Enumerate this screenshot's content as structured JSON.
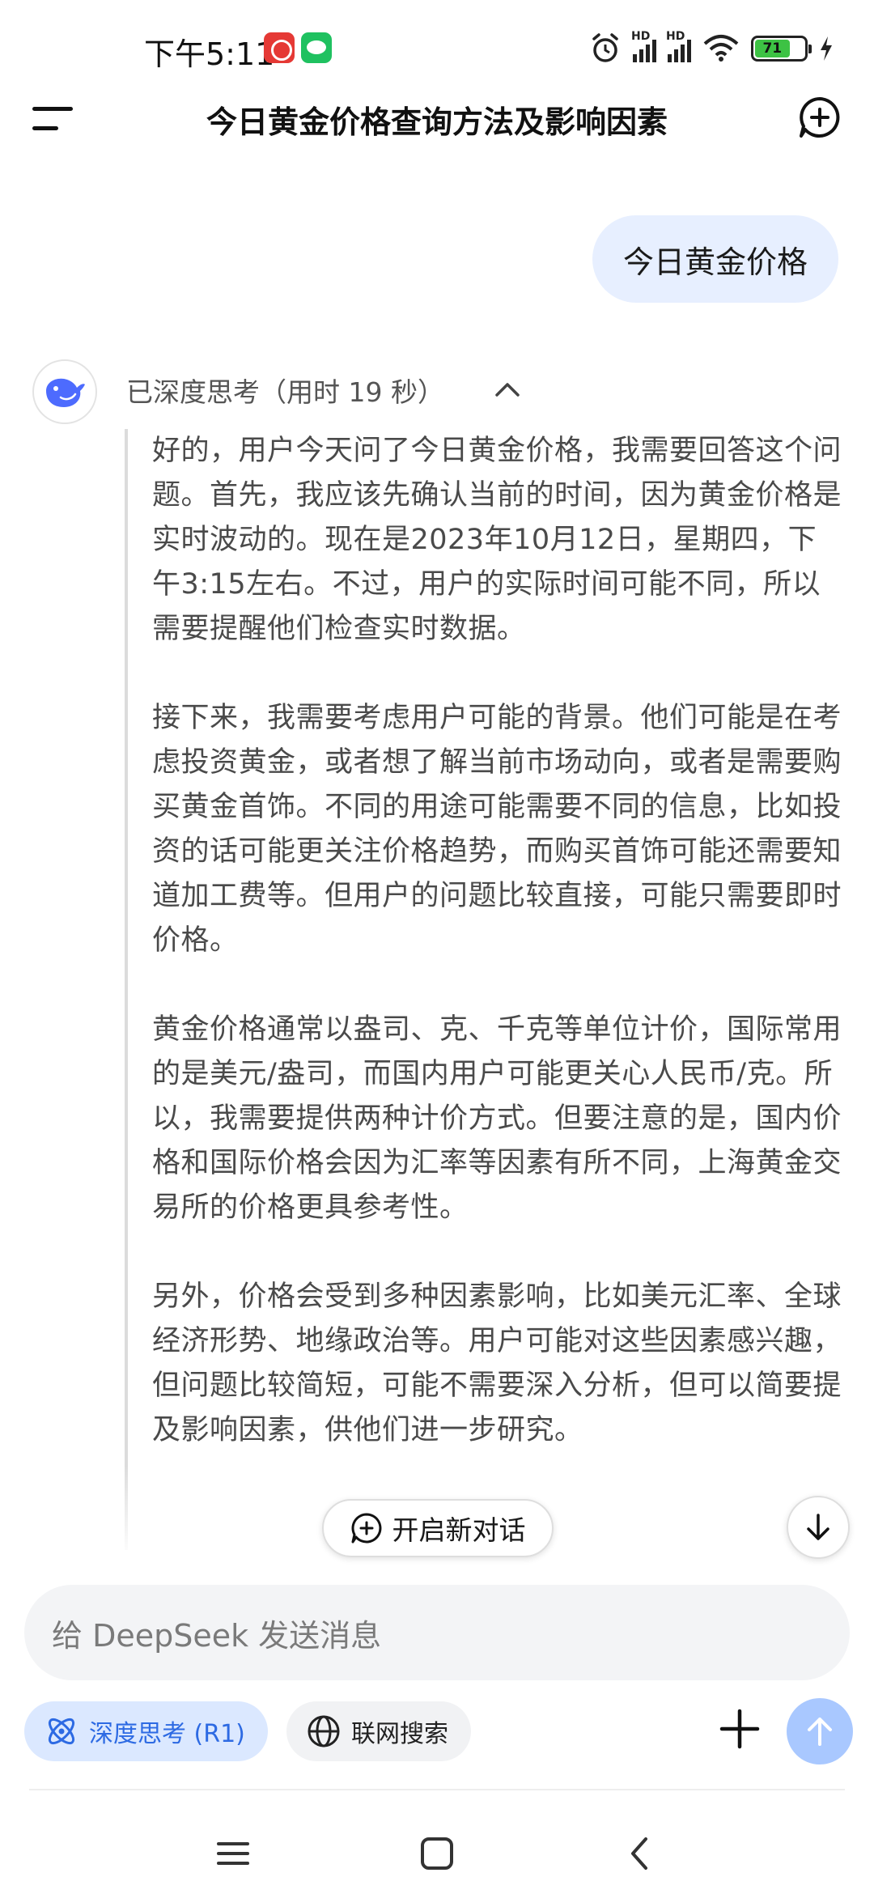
{
  "status_bar": {
    "time": "下午5:11",
    "network_hd_1": "HD",
    "network_hd_2": "HD",
    "battery_level": "71",
    "icons": [
      "app-notification-icon",
      "wechat-icon",
      "alarm-icon",
      "signal-icon",
      "wifi-icon",
      "battery-icon",
      "charging-icon"
    ]
  },
  "header": {
    "title": "今日黄金价格查询方法及影响因素"
  },
  "conversation": {
    "user_message": "今日黄金价格",
    "thinking_label": "已深度思考（用时 19 秒）",
    "thinking_paragraphs": [
      "好的，用户今天问了今日黄金价格，我需要回答这个问题。首先，我应该先确认当前的时间，因为黄金价格是实时波动的。现在是2023年10月12日，星期四，下午3:15左右。不过，用户的实际时间可能不同，所以需要提醒他们检查实时数据。",
      "接下来，我需要考虑用户可能的背景。他们可能是在考虑投资黄金，或者想了解当前市场动向，或者是需要购买黄金首饰。不同的用途可能需要不同的信息，比如投资的话可能更关注价格趋势，而购买首饰可能还需要知道加工费等。但用户的问题比较直接，可能只需要即时价格。",
      "黄金价格通常以盎司、克、千克等单位计价，国际常用的是美元/盎司，而国内用户可能更关心人民币/克。所以，我需要提供两种计价方式。但要注意的是，国内价格和国际价格会因为汇率等因素有所不同，上海黄金交易所的价格更具参考性。",
      "另外，价格会受到多种因素影响，比如美元汇率、全球经济形势、地缘政治等。用户可能对这些因素感兴趣，但问题比较简短，可能不需要深入分析，但可以简要提及影响因素，供他们进一步研究。"
    ]
  },
  "floating": {
    "new_conversation_label": "开启新对话"
  },
  "composer": {
    "placeholder": "给 DeepSeek 发送消息",
    "deep_think_label": "深度思考 (R1)",
    "web_search_label": "联网搜索"
  },
  "colors": {
    "accent_blue": "#2d6ae3",
    "deep_chip_bg": "#dbe8ff",
    "user_bubble_bg": "#e7efff",
    "send_button": "#a9c8ff",
    "deepseek_logo": "#4d6bfe"
  }
}
